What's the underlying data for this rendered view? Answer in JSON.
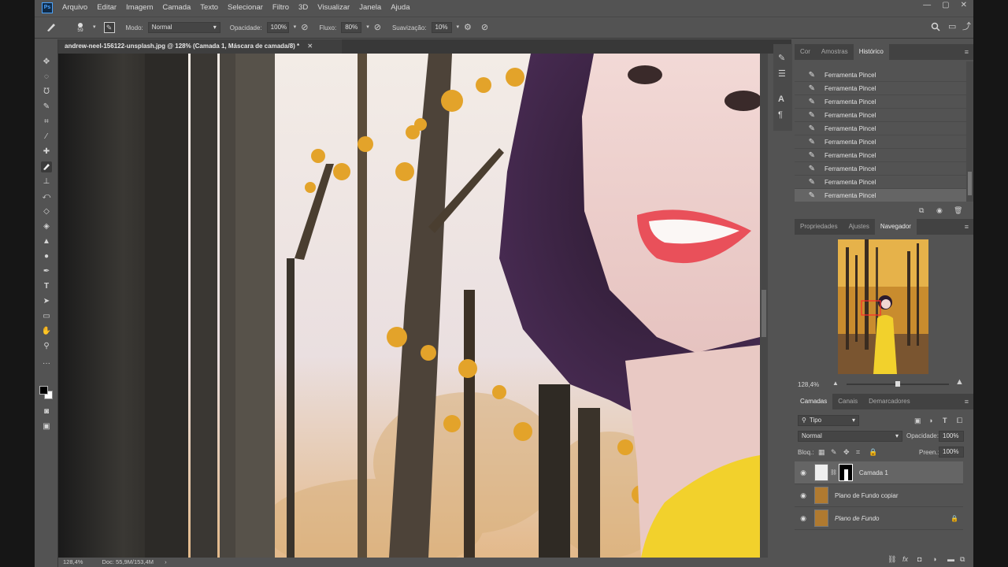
{
  "menu": {
    "logo": "Ps",
    "items": [
      "Arquivo",
      "Editar",
      "Imagem",
      "Camada",
      "Texto",
      "Selecionar",
      "Filtro",
      "3D",
      "Visualizar",
      "Janela",
      "Ajuda"
    ],
    "window_controls": [
      "—",
      "▢",
      "✕"
    ]
  },
  "options": {
    "brush_size": "59",
    "mode_label": "Modo:",
    "mode_value": "Normal",
    "opacity_label": "Opacidade:",
    "opacity_value": "100%",
    "flow_label": "Fluxo:",
    "flow_value": "80%",
    "smoothing_label": "Suavização:",
    "smoothing_value": "10%"
  },
  "document": {
    "tab_title": "andrew-neel-156122-unsplash.jpg @ 128% (Camada 1, Máscara de camada/8) *",
    "status_zoom": "128,4%",
    "status_doc": "Doc: 55,9M/153,4M"
  },
  "history_panel": {
    "tabs": [
      "Cor",
      "Amostras",
      "Histórico"
    ],
    "active_tab": "Histórico",
    "items": [
      "Ferramenta Pincel",
      "Ferramenta Pincel",
      "Ferramenta Pincel",
      "Ferramenta Pincel",
      "Ferramenta Pincel",
      "Ferramenta Pincel",
      "Ferramenta Pincel",
      "Ferramenta Pincel",
      "Ferramenta Pincel",
      "Ferramenta Pincel"
    ]
  },
  "navigator_panel": {
    "tabs": [
      "Propriedades",
      "Ajustes",
      "Navegador"
    ],
    "active_tab": "Navegador",
    "zoom": "128,4%"
  },
  "layers_panel": {
    "tabs": [
      "Camadas",
      "Canais",
      "Demarcadores"
    ],
    "active_tab": "Camadas",
    "filter_label": "Tipo",
    "blend_mode": "Normal",
    "opacity_label": "Opacidade:",
    "opacity_value": "100%",
    "lock_label": "Bloq.:",
    "fill_label": "Preen.:",
    "fill_value": "100%",
    "layers": [
      {
        "name": "Camada 1",
        "selected": true
      },
      {
        "name": "Plano de Fundo copiar",
        "selected": false
      },
      {
        "name": "Plano de Fundo",
        "selected": false,
        "locked": true
      }
    ]
  },
  "colors": {
    "ui_bg": "#535353",
    "panel_dark": "#424242",
    "selection": "#656565",
    "accent": "#4aa3ff",
    "leaves": "#e3a32a",
    "dress": "#f2d12c",
    "lips": "#e9505a"
  }
}
